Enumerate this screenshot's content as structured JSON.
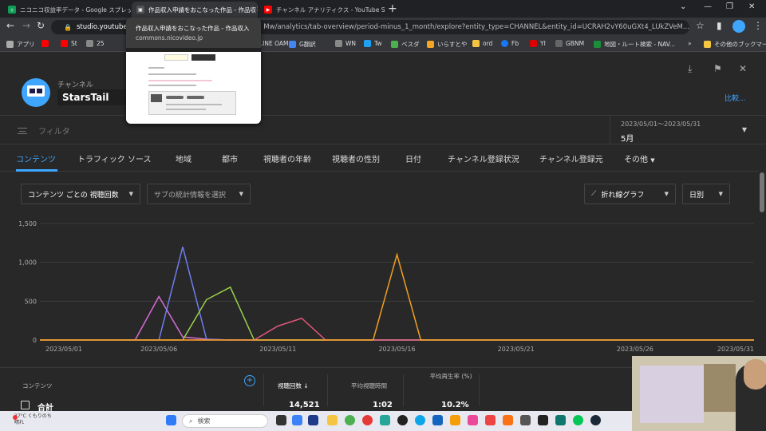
{
  "browser": {
    "tabs": [
      {
        "label": "ニコニコ収益率データ - Google スプレッ",
        "color": "#0f9d58",
        "glyph": "＋"
      },
      {
        "label": "作品収入申請をおこなった作品 - 作品収",
        "color": "#444",
        "glyph": "▣"
      },
      {
        "label": "チャンネル アナリティクス - YouTube Stu",
        "color": "#ff0000",
        "glyph": "▶"
      }
    ],
    "url_host": "studio.youtube.c",
    "url_rest": "Mw/analytics/tab-overview/period-minus_1_month/explore?entity_type=CHANNEL&entity_id=UCRAH2vY60uGXt4_LUkZVeM...",
    "bookmarks": [
      {
        "label": "アプリ",
        "color": "#aaa"
      },
      {
        "label": "",
        "color": "#ff0000"
      },
      {
        "label": "St",
        "color": "#ff0000"
      },
      {
        "label": "25",
        "color": "#888"
      },
      {
        "label": "LINE OAM",
        "color": "#06c755"
      },
      {
        "label": "G翻訳",
        "color": "#4285f4"
      },
      {
        "label": "WN",
        "color": "#888"
      },
      {
        "label": "Tw",
        "color": "#1da1f2"
      },
      {
        "label": "ベスダ",
        "color": "#4caf50"
      },
      {
        "label": "いらすとや",
        "color": "#f5a623"
      },
      {
        "label": "ord",
        "color": "#f5c542"
      },
      {
        "label": "Fb",
        "color": "#1877f2"
      },
      {
        "label": "YI",
        "color": "#d00"
      },
      {
        "label": "GBNM",
        "color": "#666"
      },
      {
        "label": "地図・ルート検索 - NAV...",
        "color": "#1a8f3a"
      },
      {
        "label": "その他のブックマーク",
        "color": "#f5c542"
      }
    ],
    "tooltip_title": "作品収入申請をおこなった作品 - 作品収入",
    "tooltip_url": "commons.nicovideo.jp"
  },
  "studio": {
    "channel_label": "チャンネル",
    "channel_name": "StarsTail",
    "compare": "比較...",
    "filter": "フィルタ",
    "date_range": "2023/05/01～2023/05/31",
    "period": "5月",
    "tabs": [
      "コンテンツ",
      "トラフィック ソース",
      "地域",
      "都市",
      "視聴者の年齢",
      "視聴者の性別",
      "日付",
      "チャンネル登録状況",
      "チャンネル登録元",
      "その他"
    ],
    "metric_dropdown": "コンテンツ ごとの 視聴回数",
    "secondary_dropdown": "サブの統計情報を選択",
    "chart_type_dropdown": "折れ線グラフ",
    "granularity_dropdown": "日別",
    "table": {
      "content_header": "コンテンツ",
      "views_header": "視聴回数",
      "avg_duration_header": "平均視聴時間",
      "avg_pct_header": "平均再生率 (%)",
      "total_label": "合計",
      "total_views": "14,521",
      "total_avg_duration": "1:02",
      "total_avg_pct": "10.2%"
    }
  },
  "chart_data": {
    "type": "line",
    "x": [
      "2023/05/01",
      "2023/05/02",
      "2023/05/03",
      "2023/05/04",
      "2023/05/05",
      "2023/05/06",
      "2023/05/07",
      "2023/05/08",
      "2023/05/09",
      "2023/05/10",
      "2023/05/11",
      "2023/05/12",
      "2023/05/13",
      "2023/05/14",
      "2023/05/15",
      "2023/05/16",
      "2023/05/17",
      "2023/05/18",
      "2023/05/19",
      "2023/05/20",
      "2023/05/21",
      "2023/05/22",
      "2023/05/23",
      "2023/05/24",
      "2023/05/25",
      "2023/05/26",
      "2023/05/27",
      "2023/05/28",
      "2023/05/29",
      "2023/05/30",
      "2023/05/31"
    ],
    "x_ticks": [
      "2023/05/01",
      "2023/05/06",
      "2023/05/11",
      "2023/05/16",
      "2023/05/21",
      "2023/05/26",
      "2023/05/31"
    ],
    "y_ticks": [
      "0",
      "500",
      "1,000",
      "1,500"
    ],
    "ylim": [
      0,
      1500
    ],
    "series": [
      {
        "color": "#d86bd6",
        "values": [
          0,
          0,
          0,
          0,
          0,
          560,
          40,
          10,
          0,
          0,
          0,
          0,
          0,
          0,
          0,
          0,
          0,
          0,
          0,
          0,
          0,
          0,
          0,
          0,
          0,
          0,
          0,
          0,
          0,
          0,
          0
        ]
      },
      {
        "color": "#6f7df0",
        "values": [
          0,
          0,
          0,
          0,
          0,
          0,
          1200,
          10,
          0,
          0,
          0,
          0,
          0,
          0,
          0,
          0,
          0,
          0,
          0,
          0,
          0,
          0,
          0,
          0,
          0,
          0,
          0,
          0,
          0,
          0,
          0
        ]
      },
      {
        "color": "#9ad04a",
        "values": [
          0,
          0,
          0,
          0,
          0,
          0,
          0,
          520,
          680,
          0,
          0,
          0,
          0,
          0,
          0,
          0,
          0,
          0,
          0,
          0,
          0,
          0,
          0,
          0,
          0,
          0,
          0,
          0,
          0,
          0,
          0
        ]
      },
      {
        "color": "#e0567a",
        "values": [
          0,
          0,
          0,
          0,
          0,
          0,
          0,
          0,
          0,
          0,
          180,
          280,
          0,
          0,
          0,
          0,
          0,
          0,
          0,
          0,
          0,
          0,
          0,
          0,
          0,
          0,
          0,
          0,
          0,
          0,
          0
        ]
      },
      {
        "color": "#f0a020",
        "values": [
          0,
          0,
          0,
          0,
          0,
          0,
          0,
          0,
          0,
          0,
          0,
          0,
          0,
          0,
          0,
          1100,
          0,
          0,
          0,
          0,
          0,
          0,
          0,
          0,
          0,
          0,
          0,
          0,
          0,
          0,
          0
        ]
      }
    ],
    "grid": true
  },
  "taskbar": {
    "weather": "27°C くもりのち晴れ",
    "search": "検索"
  }
}
